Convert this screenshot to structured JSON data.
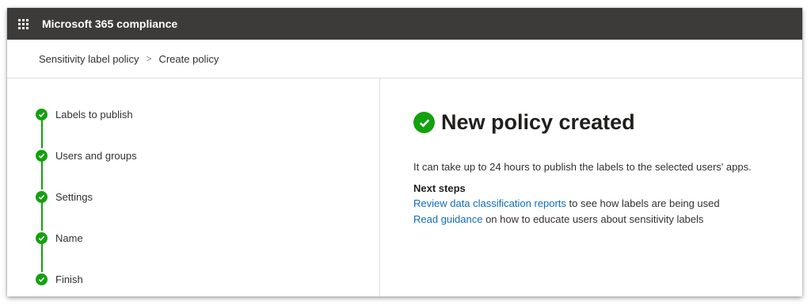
{
  "header": {
    "app_title": "Microsoft 365 compliance"
  },
  "breadcrumb": {
    "items": [
      "Sensitivity label policy",
      "Create policy"
    ],
    "separator": ">"
  },
  "steps": [
    {
      "label": "Labels to publish",
      "status": "complete"
    },
    {
      "label": "Users and groups",
      "status": "complete"
    },
    {
      "label": "Settings",
      "status": "complete"
    },
    {
      "label": "Name",
      "status": "complete"
    },
    {
      "label": "Finish",
      "status": "complete"
    }
  ],
  "main": {
    "heading": "New policy created",
    "info": "It can take up to 24 hours to publish the labels to the selected users' apps.",
    "next_steps_title": "Next steps",
    "next_steps": [
      {
        "link": "Review data classification reports",
        "rest": " to see how labels are being used"
      },
      {
        "link": "Read guidance",
        "rest": " on how to educate users about sensitivity labels"
      }
    ]
  },
  "icons": {
    "waffle": "app-launcher-icon",
    "step": "checkmark-circle-icon",
    "success": "success-checkmark-icon"
  },
  "colors": {
    "topbar": "#3c3b3a",
    "success": "#13a10e",
    "link": "#0f6cbd"
  }
}
